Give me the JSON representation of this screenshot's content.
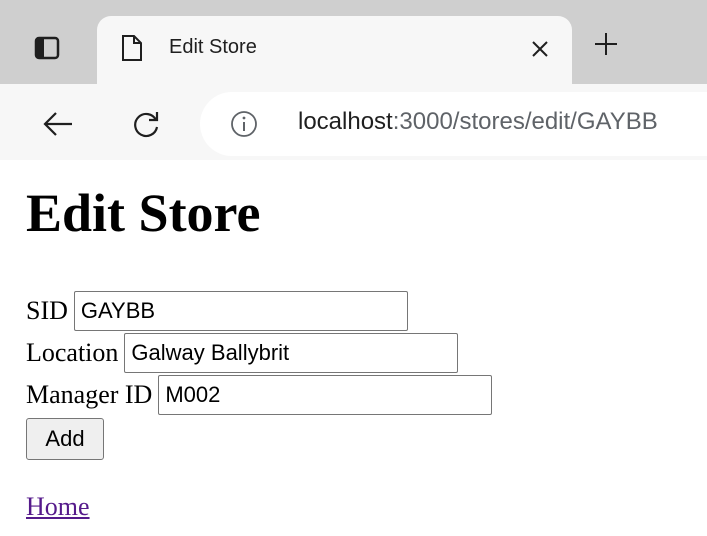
{
  "browser": {
    "tab_title": "Edit Store",
    "url_host": "localhost",
    "url_path": ":3000/stores/edit/GAYBB",
    "icons": {
      "tab_actions": "tab-actions-icon",
      "favicon": "page-icon",
      "close": "close-icon",
      "new_tab": "plus-icon",
      "back": "back-arrow-icon",
      "reload": "reload-icon",
      "site_info": "info-icon"
    }
  },
  "page": {
    "heading": "Edit Store",
    "fields": {
      "sid": {
        "label": "SID",
        "value": "GAYBB"
      },
      "location": {
        "label": "Location",
        "value": "Galway Ballybrit"
      },
      "manager": {
        "label": "Manager ID",
        "value": "M002"
      }
    },
    "submit_label": "Add",
    "home_link": "Home"
  },
  "colors": {
    "link_visited": "#551a8b",
    "chrome_background": "#cfcfcf",
    "toolbar_background": "#f7f7f7"
  }
}
